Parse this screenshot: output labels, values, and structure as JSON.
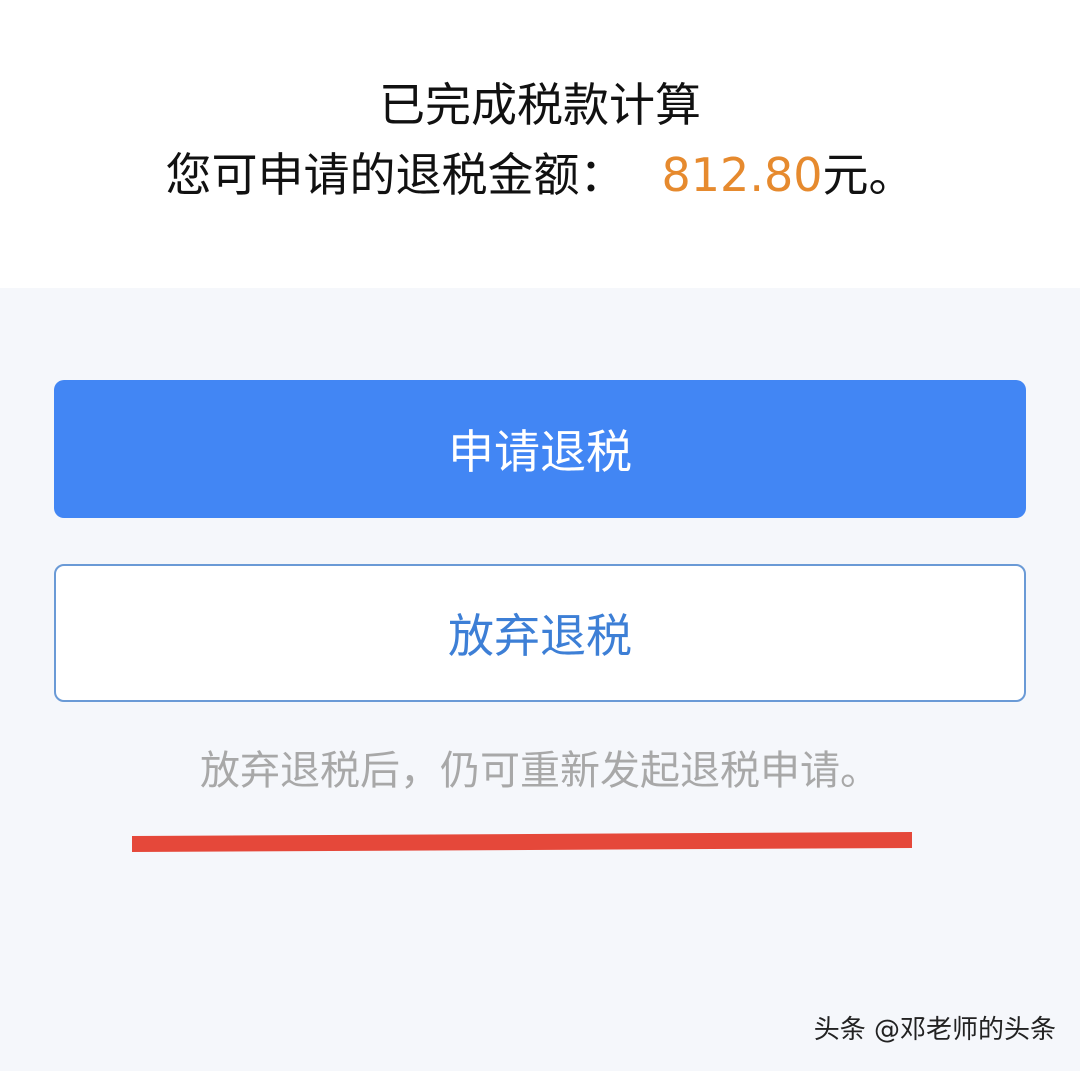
{
  "header": {
    "title": "已完成税款计算",
    "refund_label": "您可申请的退税金额：",
    "refund_amount": "812.80",
    "refund_unit": "元。"
  },
  "actions": {
    "apply_label": "申请退税",
    "abandon_label": "放弃退税"
  },
  "hint": {
    "text": "放弃退税后，仍可重新发起退税申请。"
  },
  "watermark": {
    "text": "头条 @邓老师的头条"
  },
  "colors": {
    "primary_blue": "#4286f4",
    "amount_orange": "#e68a2e",
    "underline_red": "#e5483a"
  }
}
